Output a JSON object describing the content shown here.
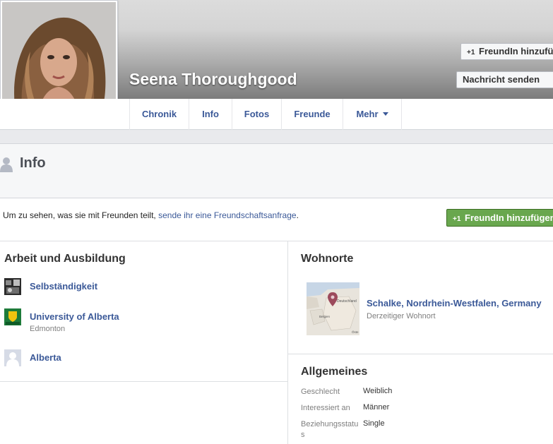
{
  "profile": {
    "name": "Seena Thoroughgood",
    "add_friend_label": "FreundIn hinzufügen",
    "message_label": "Nachricht senden",
    "plus_one": "+1"
  },
  "nav": {
    "tabs": [
      "Chronik",
      "Info",
      "Fotos",
      "Freunde",
      "Mehr"
    ]
  },
  "info": {
    "title": "Info",
    "request_text": "Um zu sehen, was sie mit Freunden teilt,",
    "request_link": "sende ihr eine Freundschaftsanfrage",
    "request_end": ".",
    "add_friend_label": "FreundIn hinzufügen"
  },
  "work": {
    "title": "Arbeit und Ausbildung",
    "items": [
      {
        "label": "Selbständigkeit",
        "sub": ""
      },
      {
        "label": "University of Alberta",
        "sub": "Edmonton"
      },
      {
        "label": "Alberta",
        "sub": ""
      }
    ]
  },
  "places": {
    "title": "Wohnorte",
    "current": "Schalke, Nordrhein-Westfalen, Germany",
    "current_sub": "Derzeitiger Wohnort",
    "map_labels": [
      "Deutschland",
      "Belgien",
      "Öste"
    ]
  },
  "general": {
    "title": "Allgemeines",
    "rows": [
      {
        "key": "Geschlecht",
        "value": "Weiblich"
      },
      {
        "key": "Interessiert an",
        "value": "Männer"
      },
      {
        "key": "Beziehungsstatus",
        "value": "Single"
      }
    ]
  },
  "colors": {
    "link": "#3b5998",
    "green_button": "#69a74e"
  }
}
